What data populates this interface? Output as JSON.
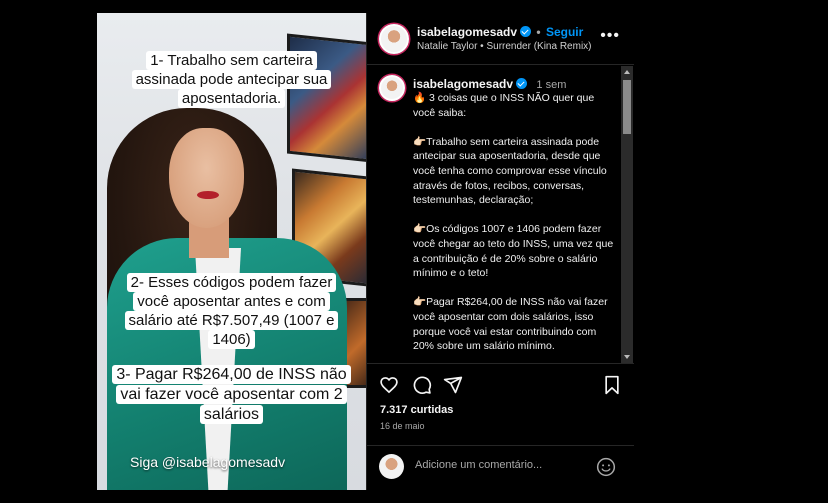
{
  "media": {
    "caption_1": "1- Trabalho sem carteira assinada pode antecipar sua aposentadoria.",
    "caption_2": "2- Esses códigos podem fazer você aposentar antes e com salário até R$7.507,49 (1007 e 1406)",
    "caption_3": "3- Pagar R$264,00 de INSS não vai fazer você aposentar com 2 salários",
    "follow_text": "Siga @isabelagomesadv",
    "mute_icon": "speaker-muted-icon"
  },
  "header": {
    "username": "isabelagomesadv",
    "separator": "•",
    "follow_label": "Seguir",
    "music": "Natalie Taylor • Surrender (Kina Remix)",
    "more_label": "•••"
  },
  "post": {
    "username": "isabelagomesadv",
    "time": "1 sem",
    "caption": "🔥 3 coisas que o INSS NÃO quer que você saiba:\n\n👉🏻Trabalho sem carteira assinada pode antecipar sua aposentadoria, desde que você tenha como comprovar esse vínculo através de fotos, recibos, conversas, testemunhas, declaração;\n\n👉🏻Os códigos 1007 e 1406 podem fazer você chegar ao teto do INSS, uma vez que a contribuição é de 20% sobre o salário mínimo e o teto!\n\n👉🏻Pagar R$264,00 de INSS não vai fazer você aposentar com dois salários, isso porque você vai estar contribuindo com 20% sobre um salário mínimo.\n\n👉🏻"
  },
  "actions": {
    "icons": [
      "heart-icon",
      "comment-icon",
      "share-icon",
      "bookmark-icon"
    ],
    "likes": "7.317 curtidas",
    "date": "16 de maio"
  },
  "comment": {
    "placeholder": "Adicione um comentário..."
  },
  "colors": {
    "accent": "#0095f6",
    "background": "#000000",
    "blazer": "#13806f"
  }
}
